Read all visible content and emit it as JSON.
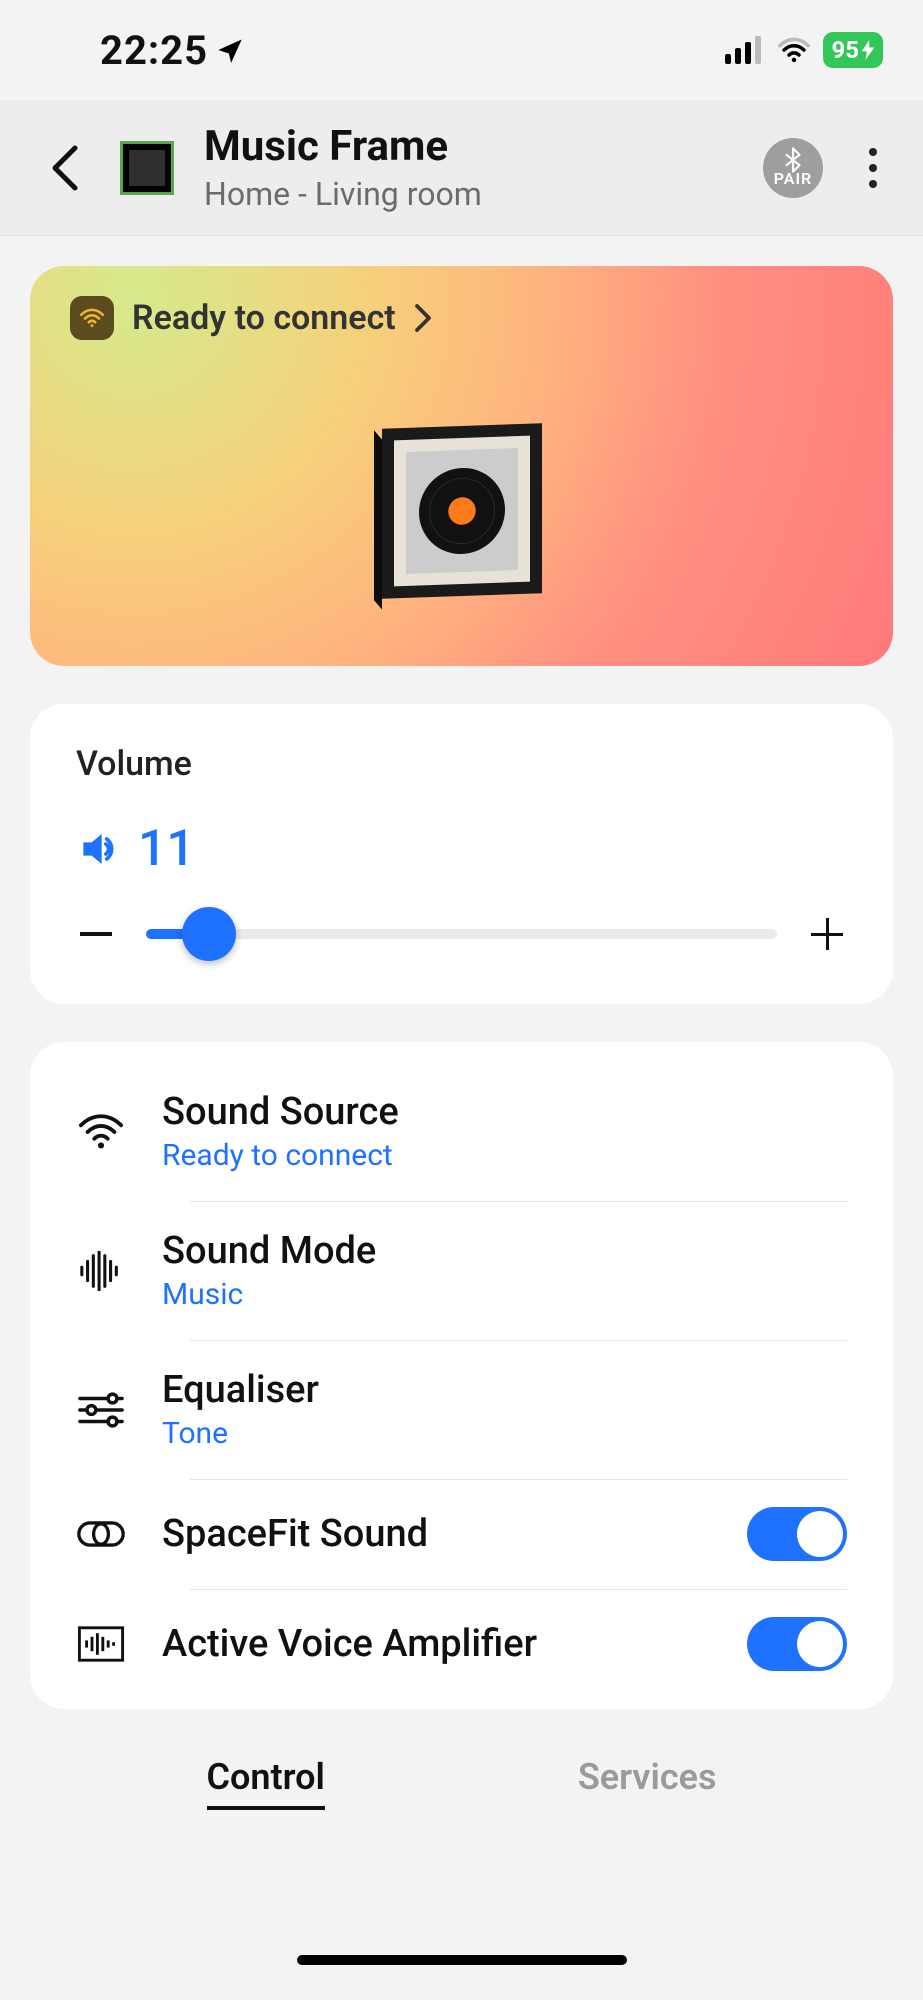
{
  "status": {
    "time": "22:25",
    "battery": "95"
  },
  "header": {
    "title": "Music Frame",
    "subtitle": "Home - Living room",
    "pair_label": "PAIR"
  },
  "hero": {
    "status": "Ready to connect"
  },
  "volume": {
    "title": "Volume",
    "value": "11",
    "percent": 10
  },
  "settings": {
    "source": {
      "title": "Sound Source",
      "sub": "Ready to connect"
    },
    "mode": {
      "title": "Sound Mode",
      "sub": "Music"
    },
    "eq": {
      "title": "Equaliser",
      "sub": "Tone"
    },
    "spacefit": {
      "title": "SpaceFit Sound",
      "state": "on"
    },
    "ava": {
      "title": "Active Voice Amplifier",
      "state": "on"
    }
  },
  "tabs": {
    "control": "Control",
    "services": "Services"
  }
}
